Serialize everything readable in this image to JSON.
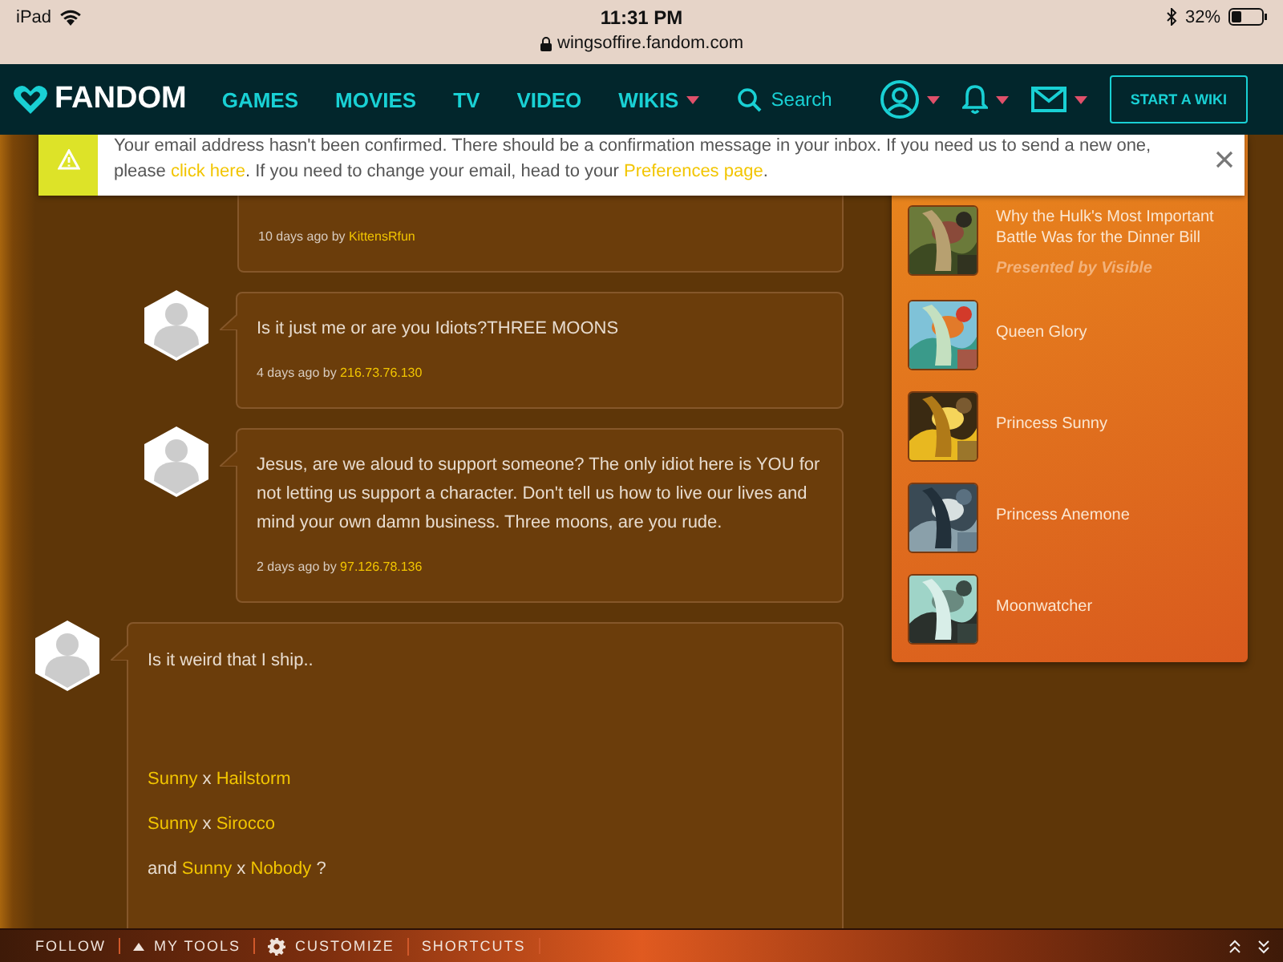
{
  "status_bar": {
    "device": "iPad",
    "time": "11:31 PM",
    "url": "wingsoffire.fandom.com",
    "battery": "32%"
  },
  "nav": {
    "logo": "FANDOM",
    "links": [
      {
        "label": "GAMES",
        "dropdown": false
      },
      {
        "label": "MOVIES",
        "dropdown": false
      },
      {
        "label": "TV",
        "dropdown": false
      },
      {
        "label": "VIDEO",
        "dropdown": false
      },
      {
        "label": "WIKIS",
        "dropdown": true
      }
    ],
    "search": "Search",
    "button": "START A WIKI"
  },
  "notice": {
    "segments": [
      {
        "text": "Your email address hasn't been confirmed. There should be a confirmation message in your inbox. If you need us to send a new one, please ",
        "link": false
      },
      {
        "text": "click here",
        "link": true
      },
      {
        "text": ". If you need to change your email, head to your ",
        "link": false
      },
      {
        "text": "Preferences page",
        "link": true
      },
      {
        "text": ".",
        "link": false
      }
    ]
  },
  "comments": [
    {
      "reply": true,
      "meta": "10 days ago by ",
      "author": "KittensRfun"
    },
    {
      "reply": true,
      "lines": [
        [
          {
            "text": "Is it just me or are you Idiots?THREE MOONS",
            "link": false
          }
        ]
      ],
      "meta": "4 days ago by ",
      "author": "216.73.76.130"
    },
    {
      "reply": true,
      "lines": [
        [
          {
            "text": "Jesus, are we aloud to support someone? The only idiot here is YOU for not letting us support a character. Don't tell us how to live our lives and mind your own damn business. Three moons, are you rude.",
            "link": false
          }
        ]
      ],
      "meta": "2 days ago by ",
      "author": "97.126.78.136"
    },
    {
      "reply": false,
      "lines": [
        [
          {
            "text": "Is it weird that I ship..",
            "link": false
          }
        ],
        [
          {
            "text": "Sunny",
            "link": true
          },
          {
            "text": " x ",
            "link": false
          },
          {
            "text": "Hailstorm",
            "link": true
          }
        ],
        [
          {
            "text": "Sunny",
            "link": true
          },
          {
            "text": " x ",
            "link": false
          },
          {
            "text": "Sirocco",
            "link": true
          }
        ],
        [
          {
            "text": "and ",
            "link": false
          },
          {
            "text": "Sunny",
            "link": true
          },
          {
            "text": " x ",
            "link": false
          },
          {
            "text": "Nobody",
            "link": true
          },
          {
            "text": " ?",
            "link": false
          }
        ]
      ]
    }
  ],
  "rail": [
    {
      "title": "Why the Hulk's Most Important Battle Was for the Dinner Bill",
      "sponsor": "Presented by Visible"
    },
    {
      "title": "Queen Glory"
    },
    {
      "title": "Princess Sunny"
    },
    {
      "title": "Princess Anemone"
    },
    {
      "title": "Moonwatcher"
    }
  ],
  "toolbar": [
    {
      "label": "FOLLOW",
      "kind": "plain"
    },
    {
      "label": "MY TOOLS",
      "kind": "menu"
    },
    {
      "label": "CUSTOMIZE",
      "kind": "settings"
    },
    {
      "label": "SHORTCUTS",
      "kind": "plain"
    }
  ]
}
